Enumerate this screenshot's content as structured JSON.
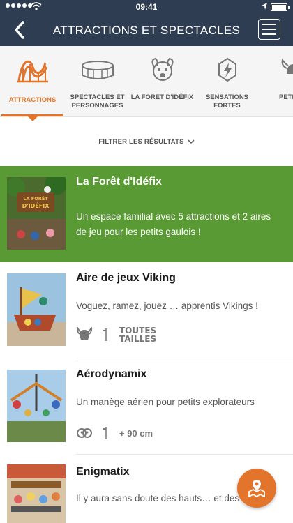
{
  "status_bar": {
    "time": "09:41"
  },
  "header": {
    "title": "ATTRACTIONS ET SPECTACLES"
  },
  "tabs": [
    {
      "label": "ATTRACTIONS",
      "icon": "rollercoaster-icon",
      "active": true
    },
    {
      "label": "SPECTACLES ET PERSONNAGES",
      "icon": "arena-icon",
      "active": false
    },
    {
      "label": "LA FORET D'IDÉFIX",
      "icon": "idefix-dog-icon",
      "active": false
    },
    {
      "label": "SENSATIONS FORTES",
      "icon": "lightning-icon",
      "active": false
    },
    {
      "label": "PETIT G",
      "icon": "helmet-icon",
      "active": false
    }
  ],
  "filter": {
    "label": "FILTRER LES RÉSULTATS"
  },
  "items": [
    {
      "name": "La Forêt d'Idéfix",
      "description": "Un espace familial avec 5 attractions et 2 aires de jeu pour les petits gaulois !",
      "thumb_text": "LA FORÊT D'IDÉFIX",
      "featured": true
    },
    {
      "name": "Aire de jeux Viking",
      "description": "Voguez, ramez, jouez … apprentis Vikings !",
      "size_line1": "TOUTES",
      "size_line2": "TAILLES",
      "icon": "viking-helmet-icon"
    },
    {
      "name": "Aérodynamix",
      "description": "Un manège aérien pour petits explorateurs",
      "height": "+ 90 cm",
      "icon": "family-icon"
    },
    {
      "name": "Enigmatix",
      "description": "Il y aura sans doute des hauts… et des"
    }
  ],
  "colors": {
    "header": "#2f3d52",
    "accent": "#e2742c",
    "featured": "#5a9a35"
  }
}
